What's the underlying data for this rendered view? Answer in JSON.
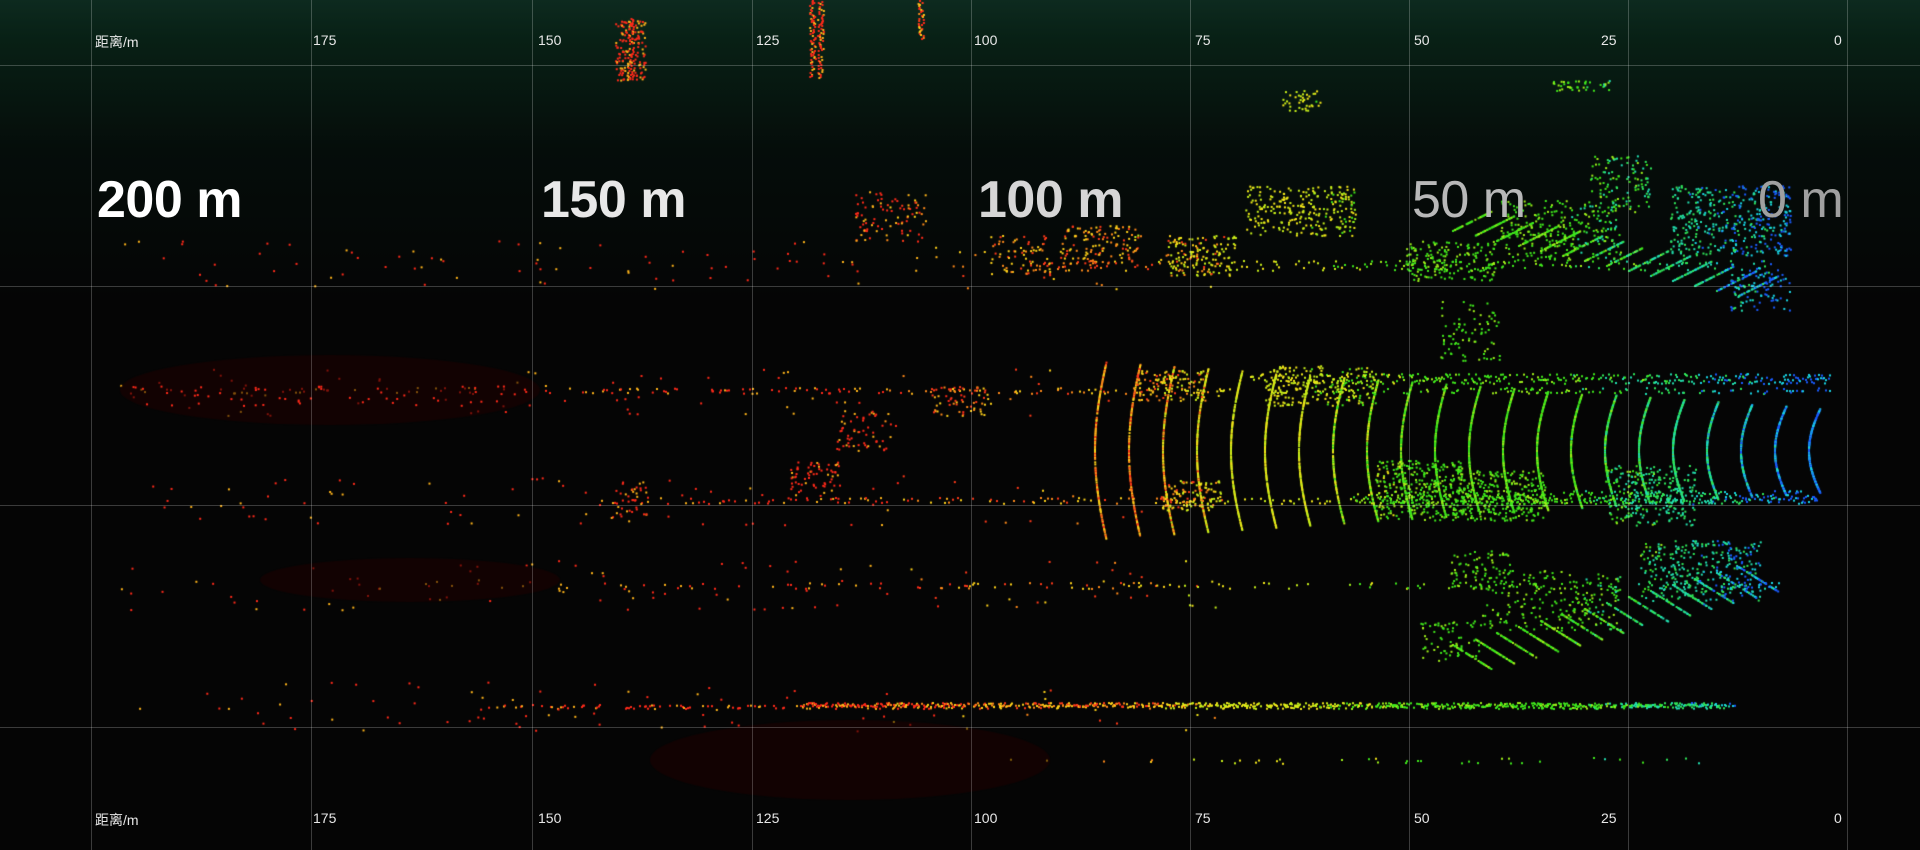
{
  "scale": {
    "unit_label": "距离/m",
    "ticks": [
      "175",
      "150",
      "125",
      "100",
      "75",
      "50",
      "25",
      "0"
    ]
  },
  "distance_markers": [
    {
      "label": "200 m",
      "color": "#ffffff"
    },
    {
      "label": "150 m",
      "color": "#e8e8e8"
    },
    {
      "label": "100 m",
      "color": "#d6d6d6"
    },
    {
      "label": "50 m",
      "color": "#b8b8b8"
    },
    {
      "label": "0 m",
      "color": "#a0a0a0"
    }
  ],
  "colors": {
    "background": "#050505",
    "near_points": "#1a4fff",
    "mid_points": "#33e61a",
    "far_points": "#ff2a1a"
  }
}
